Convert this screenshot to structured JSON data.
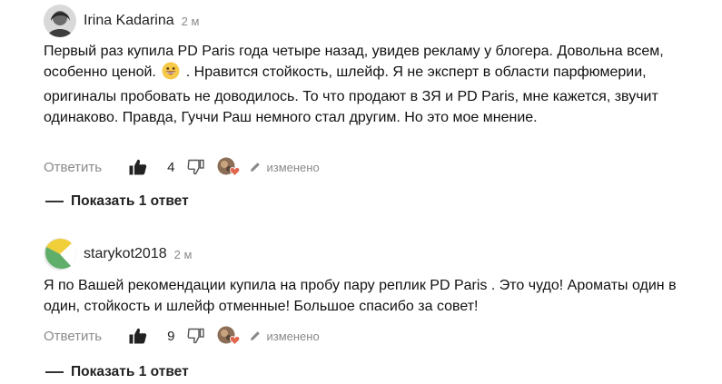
{
  "comments": [
    {
      "author": "Irina Kadarina",
      "time": "2 м",
      "text_before_emoji": "Первый раз купила PD Paris года четыре назад, увидев рекламу у блогера. Довольна всем, особенно ценой.",
      "emoji": "grinning-face-emoji",
      "text_after_emoji": ". Нравится стойкость, шлейф. Я не эксперт в области парфюмерии, оригиналы пробовать не доводилось. То что продают в ЗЯ и PD Paris, мне кажется, звучит одинаково. Правда, Гуччи Раш немного стал другим. Но это мое мнение.",
      "reply_label": "Ответить",
      "likes": "4",
      "edited_label": "изменено",
      "show_replies_label": "Показать 1 ответ"
    },
    {
      "author": "starykot2018",
      "time": "2 м",
      "text": "Я по Вашей рекомендации купила на пробу пару реплик PD Paris . Это чудо! Ароматы один в один, стойкость и шлейф отменные! Большое спасибо за совет!",
      "reply_label": "Ответить",
      "likes": "9",
      "edited_label": "изменено",
      "show_replies_label": "Показать 1 ответ"
    }
  ],
  "colors": {
    "muted_text": "#8a8a8a",
    "avatar2_yellow": "#f1cf3a",
    "avatar2_green": "#5fae6a",
    "heart": "#e0654a"
  },
  "icons": [
    "thumbs-up-icon",
    "thumbs-down-icon",
    "pencil-icon",
    "heart-icon"
  ]
}
